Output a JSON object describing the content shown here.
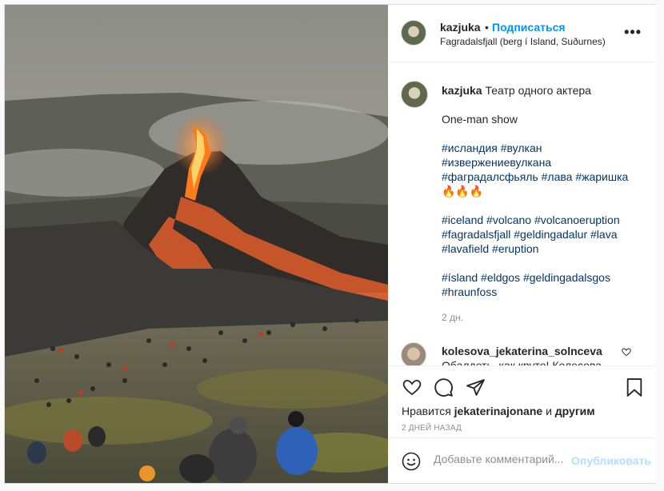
{
  "post": {
    "author": "kazjuka",
    "follow_label": "Подписаться",
    "separator": "•",
    "location": "Fagradalsfjall (berg í Island, Suðurnes)",
    "more_label": "•••"
  },
  "caption": {
    "username": "kazjuka",
    "text": "Театр одного актера",
    "line2": "One-man show",
    "tags_ru_1": "#исландия #вулкан",
    "tags_ru_2": "#извержениевулкана",
    "tags_ru_3": "#фаградалсфьяль #лава #жаришка",
    "emoji": "🔥🔥🔥",
    "tags_en_1": "#iceland #volcano #volcanoeruption",
    "tags_en_2": "#fagradalsfjall #geldingadalur #lava",
    "tags_en_3": "#lavafield #eruption",
    "tags_is_1": "#ísland #eldgos #geldingadalsgos",
    "tags_is_2": "#hraunfoss",
    "age": "2 дн."
  },
  "comment": {
    "username": "kolesova_jekaterina_solnceva",
    "text": "Обалдеть, как круто! Колесова"
  },
  "actions": {
    "icons": [
      "heart-icon",
      "comment-icon",
      "share-icon",
      "bookmark-icon"
    ]
  },
  "likes": {
    "prefix": "Нравится",
    "user": "jekaterinajonane",
    "and": "и",
    "others": "другим"
  },
  "date": "2 ДНЕЙ НАЗАД",
  "add_comment": {
    "placeholder": "Добавьте комментарий...",
    "publish_label": "Опубликовать"
  },
  "colors": {
    "accent": "#0095f6",
    "publish_disabled": "#b2dffc",
    "tag": "#00376b"
  }
}
